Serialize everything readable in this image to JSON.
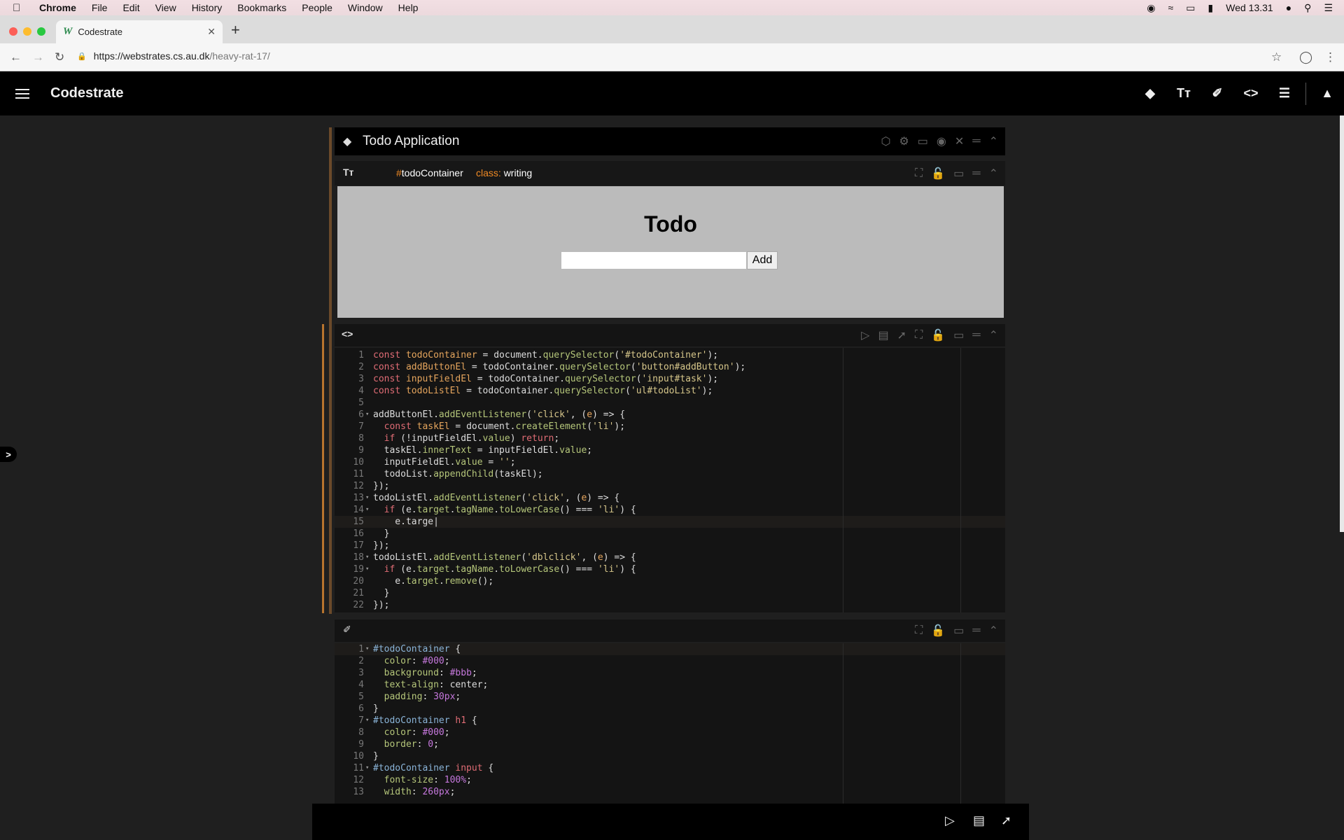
{
  "menubar": {
    "app": "Chrome",
    "items": [
      "File",
      "Edit",
      "View",
      "History",
      "Bookmarks",
      "People",
      "Window",
      "Help"
    ],
    "clock": "Wed 13.31"
  },
  "browser": {
    "tab_title": "Codestrate",
    "url_host": "https://webstrates.cs.au.dk",
    "url_path": "/heavy-rat-17/"
  },
  "app": {
    "title": "Codestrate"
  },
  "section": {
    "title": "Todo Application"
  },
  "writing": {
    "id_hash": "#",
    "id": "todoContainer",
    "class_key": "class:",
    "class_value": "writing"
  },
  "preview": {
    "heading": "Todo",
    "input_value": "",
    "button": "Add"
  },
  "js_code": [
    {
      "n": "1",
      "html": "<span class='kw'>const</span> <span class='var'>todoContainer</span> = document.<span class='mth'>querySelector</span>(<span class='str'>'#todoContainer'</span>);"
    },
    {
      "n": "2",
      "html": "<span class='kw'>const</span> <span class='var'>addButtonEl</span> = todoContainer.<span class='mth'>querySelector</span>(<span class='str'>'button#addButton'</span>);"
    },
    {
      "n": "3",
      "html": "<span class='kw'>const</span> <span class='var'>inputFieldEl</span> = todoContainer.<span class='mth'>querySelector</span>(<span class='str'>'input#task'</span>);"
    },
    {
      "n": "4",
      "html": "<span class='kw'>const</span> <span class='var'>todoListEl</span> = todoContainer.<span class='mth'>querySelector</span>(<span class='str'>'ul#todoList'</span>);"
    },
    {
      "n": "5",
      "html": ""
    },
    {
      "n": "6",
      "fold": true,
      "html": "addButtonEl.<span class='mth'>addEventListener</span>(<span class='str'>'click'</span>, (<span class='var'>e</span>) =&gt; {"
    },
    {
      "n": "7",
      "html": "  <span class='kw'>const</span> <span class='var'>taskEl</span> = document.<span class='mth'>createElement</span>(<span class='str'>'li'</span>);"
    },
    {
      "n": "8",
      "html": "  <span class='kw'>if</span> (!inputFieldEl.<span class='mth'>value</span>) <span class='kw'>return</span>;"
    },
    {
      "n": "9",
      "html": "  taskEl.<span class='mth'>innerText</span> = inputFieldEl.<span class='mth'>value</span>;"
    },
    {
      "n": "10",
      "html": "  inputFieldEl.<span class='mth'>value</span> = <span class='str'>''</span>;"
    },
    {
      "n": "11",
      "html": "  todoList.<span class='mth'>appendChild</span>(taskEl);"
    },
    {
      "n": "12",
      "html": "});"
    },
    {
      "n": "13",
      "fold": true,
      "html": "todoListEl.<span class='mth'>addEventListener</span>(<span class='str'>'click'</span>, (<span class='var'>e</span>) =&gt; {"
    },
    {
      "n": "14",
      "fold": true,
      "html": "  <span class='kw'>if</span> (e.<span class='mth'>target</span>.<span class='mth'>tagName</span>.<span class='mth'>toLowerCase</span>() === <span class='str'>'li'</span>) {"
    },
    {
      "n": "15",
      "active": true,
      "html": "    e.targe|"
    },
    {
      "n": "16",
      "html": "  }"
    },
    {
      "n": "17",
      "html": "});"
    },
    {
      "n": "18",
      "fold": true,
      "html": "todoListEl.<span class='mth'>addEventListener</span>(<span class='str'>'dblclick'</span>, (<span class='var'>e</span>) =&gt; {"
    },
    {
      "n": "19",
      "fold": true,
      "html": "  <span class='kw'>if</span> (e.<span class='mth'>target</span>.<span class='mth'>tagName</span>.<span class='mth'>toLowerCase</span>() === <span class='str'>'li'</span>) {"
    },
    {
      "n": "20",
      "html": "    e.<span class='mth'>target</span>.<span class='mth'>remove</span>();"
    },
    {
      "n": "21",
      "html": "  }"
    },
    {
      "n": "22",
      "html": "});"
    }
  ],
  "css_code": [
    {
      "n": "1",
      "fold": true,
      "active": true,
      "html": "<span class='sel'>#todoContainer</span> {"
    },
    {
      "n": "2",
      "html": "  <span class='mth'>color</span>: <span class='num'>#000</span>;"
    },
    {
      "n": "3",
      "html": "  <span class='mth'>background</span>: <span class='num'>#bbb</span>;"
    },
    {
      "n": "4",
      "html": "  <span class='mth'>text-align</span>: center;"
    },
    {
      "n": "5",
      "html": "  <span class='mth'>padding</span>: <span class='num'>30px</span>;"
    },
    {
      "n": "6",
      "html": "}"
    },
    {
      "n": "7",
      "fold": true,
      "html": "<span class='sel'>#todoContainer</span> <span class='tagc'>h1</span> {"
    },
    {
      "n": "8",
      "html": "  <span class='mth'>color</span>: <span class='num'>#000</span>;"
    },
    {
      "n": "9",
      "html": "  <span class='mth'>border</span>: <span class='num'>0</span>;"
    },
    {
      "n": "10",
      "html": "}"
    },
    {
      "n": "11",
      "fold": true,
      "html": "<span class='sel'>#todoContainer</span> <span class='tagc'>input</span> {"
    },
    {
      "n": "12",
      "html": "  <span class='mth'>font-size</span>: <span class='num'>100%</span>;"
    },
    {
      "n": "13",
      "html": "  <span class='mth'>width</span>: <span class='num'>260px</span>;"
    }
  ],
  "colors": {
    "accent_orange": "#f08a24",
    "app_bg": "#1f1f1f",
    "editor_bg": "#141414",
    "preview_bg": "#bbb"
  }
}
